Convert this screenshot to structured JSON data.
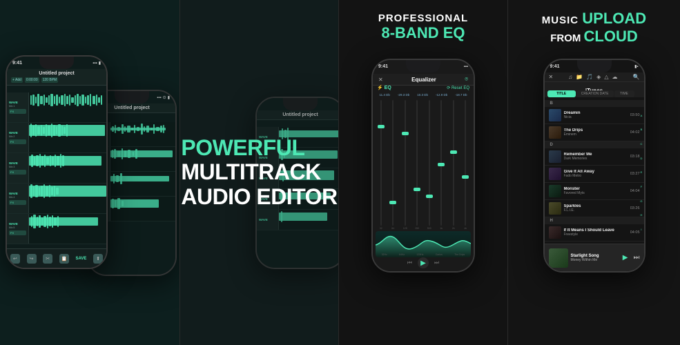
{
  "panels": [
    {
      "id": "multitrack",
      "bg": "#0d1f1e",
      "phone": {
        "status_time": "9:41",
        "title": "Untitled project",
        "tracks": [
          {
            "label": "WAVE MIX",
            "sub": "Music Track 1",
            "duration": "0:55",
            "fx": true
          },
          {
            "label": "WAVE MIX",
            "sub": "Explore - The Drops",
            "duration": "0:32",
            "fx": true
          },
          {
            "label": "WAVE MIX",
            "sub": "Fades Metro & All Items",
            "duration": "1:24",
            "fx": true
          },
          {
            "label": "WAVE MIX",
            "sub": "Bunny Morris - Can't Walk Anymore",
            "duration": "0:47",
            "fx": true
          },
          {
            "label": "WAVE MIX",
            "sub": "Track 5",
            "duration": "0:33",
            "fx": true
          }
        ]
      },
      "phone2": {
        "status_time": "9:41",
        "title": "Untitled project"
      }
    },
    {
      "id": "headline",
      "bg": "#111c1c",
      "headline_line1": "POWERFUL",
      "headline_line2": "MULTITRACK",
      "headline_line3": "AUDIO EDITOR"
    },
    {
      "id": "equalizer",
      "bg": "#131313",
      "headline_line1": "PROFESSIONAL",
      "headline_line2": "8-BAND EQ",
      "phone": {
        "status_time": "9:41",
        "title": "Equalizer",
        "bands": [
          {
            "freq": "32Hz",
            "value": "11.4 Db",
            "pos_pct": 25
          },
          {
            "freq": "64Hz",
            "value": "-29.3 Db",
            "pos_pct": 85
          },
          {
            "freq": "125Hz",
            "value": "10.3 Db",
            "pos_pct": 28
          },
          {
            "freq": "250Hz",
            "value": "-12.9 Db",
            "pos_pct": 75
          },
          {
            "freq": "500Hz",
            "value": "-18.7 Db",
            "pos_pct": 80
          },
          {
            "freq": "1kHz",
            "value": "0 Db",
            "pos_pct": 50
          },
          {
            "freq": "2kHz",
            "value": "5 Db",
            "pos_pct": 40
          },
          {
            "freq": "4kHz",
            "value": "-5 Db",
            "pos_pct": 60
          }
        ]
      }
    },
    {
      "id": "itunes",
      "bg": "#141414",
      "headline_line1": "MUSIC",
      "headline_line2": "UPLOAD",
      "headline_line3": "FROM CLOUD",
      "phone": {
        "status_time": "9:41",
        "source": "iTunes",
        "tabs": [
          "TITLE",
          "CREATION DATE",
          "TIME"
        ],
        "songs": [
          {
            "section": "B",
            "title": "Dreamin",
            "artist": "Nicia",
            "duration": "03:50"
          },
          {
            "section": "",
            "title": "The Drips",
            "artist": "Eminem",
            "duration": "04:02"
          },
          {
            "section": "D",
            "title": "Remember Me",
            "artist": "Dark Memories",
            "duration": "03:18"
          },
          {
            "section": "",
            "title": "Give It All Away",
            "artist": "Fado Metro",
            "duration": "03:27"
          },
          {
            "section": "",
            "title": "Monster",
            "artist": "Favored Myts",
            "duration": "04:04"
          },
          {
            "section": "",
            "title": "Sparkles",
            "artist": "F.L.I.E.",
            "duration": "03:26"
          },
          {
            "section": "H",
            "title": "If It Means I Should Leave",
            "artist": "Freestyle",
            "duration": "04:05"
          }
        ],
        "now_playing": {
          "title": "Starlight Song",
          "artist": "Money Within Me"
        }
      }
    }
  ]
}
